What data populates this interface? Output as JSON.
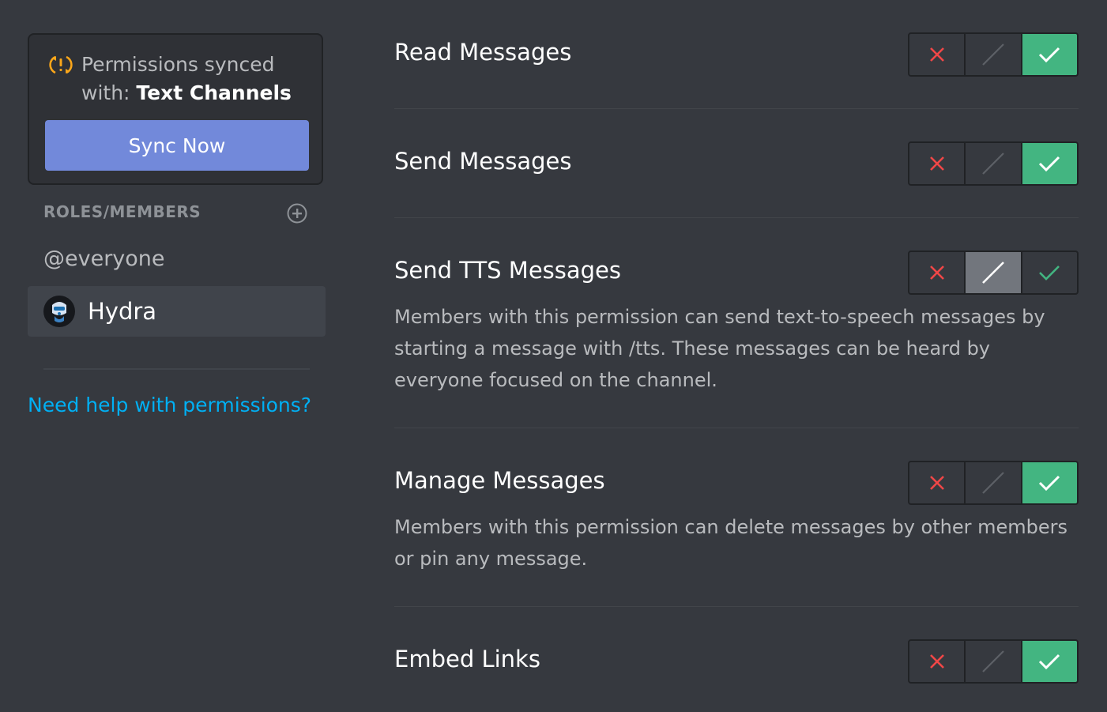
{
  "sync_card": {
    "text_prefix": "Permissions synced with:",
    "channel_name": "Text Channels",
    "button_label": "Sync Now",
    "icon": "sync-warning-icon"
  },
  "roles": {
    "header": "ROLES/MEMBERS",
    "add_icon": "add-circle-icon",
    "items": [
      {
        "label": "@everyone",
        "selected": false
      },
      {
        "label": "Hydra",
        "selected": true,
        "icon": "hydra-avatar"
      }
    ]
  },
  "help_link": "Need help with permissions?",
  "permissions": [
    {
      "title": "Read Messages",
      "description": "",
      "state": "allow"
    },
    {
      "title": "Send Messages",
      "description": "",
      "state": "allow"
    },
    {
      "title": "Send TTS Messages",
      "description": "Members with this permission can send text-to-speech messages by starting a message with /tts. These messages can be heard by everyone focused on the channel.",
      "state": "neutral"
    },
    {
      "title": "Manage Messages",
      "description": "Members with this permission can delete messages by other members or pin any message.",
      "state": "allow"
    },
    {
      "title": "Embed Links",
      "description": "",
      "state": "allow"
    }
  ],
  "colors": {
    "background": "#36393f",
    "card": "#2f3136",
    "accent_blurple": "#7289da",
    "allow_green": "#43b581",
    "deny_red": "#f04747",
    "neutral_gray": "#72767d",
    "link_blue": "#00b0f4"
  }
}
